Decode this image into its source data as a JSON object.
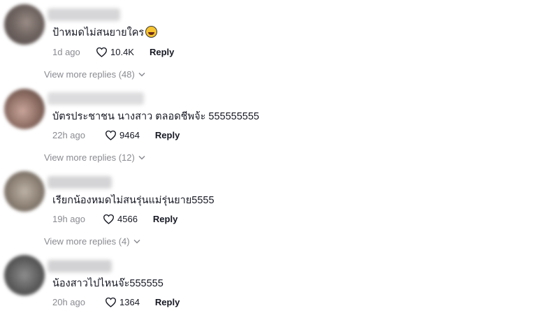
{
  "comments": [
    {
      "text": "ป้าหมดไม่สนยายใคร",
      "emoji_icon": "laughing-face-emoji",
      "time": "1d ago",
      "likes": "10.4K",
      "reply_label": "Reply",
      "view_more": "View more replies (48)"
    },
    {
      "text": "บัตรประชาชน นางสาว ตลอดชีพจ้ะ 555555555",
      "time": "22h ago",
      "likes": "9464",
      "reply_label": "Reply",
      "view_more": "View more replies (12)"
    },
    {
      "text": "เรียกน้องหมดไม่สนรุ่นแม่รุ่นยาย5555",
      "time": "19h ago",
      "likes": "4566",
      "reply_label": "Reply",
      "view_more": "View more replies (4)"
    },
    {
      "text": "น้องสาวไปไหนจ๊ะ555555",
      "time": "20h ago",
      "likes": "1364",
      "reply_label": "Reply"
    }
  ],
  "colors": {
    "text_primary": "#161823",
    "text_secondary": "#8a8b91",
    "background": "#ffffff"
  }
}
